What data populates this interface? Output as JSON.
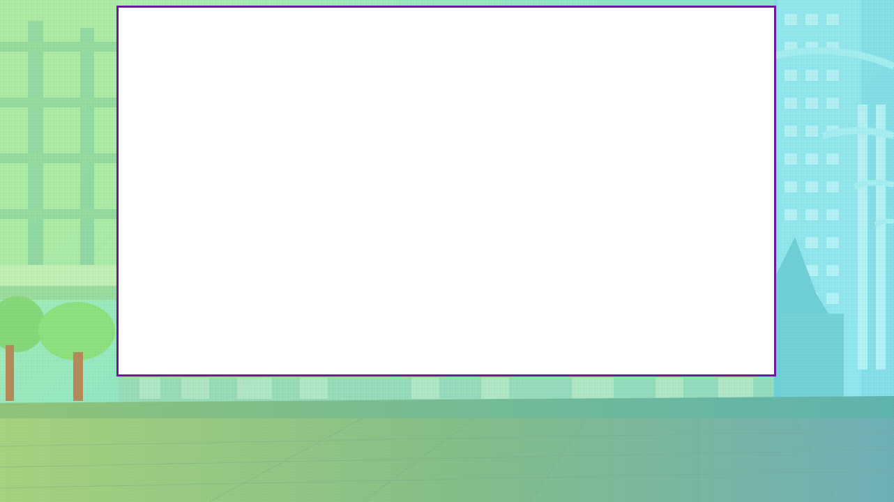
{
  "scene": {
    "background_name": "city-street-backdrop",
    "colors": {
      "sky_cyan": "#7de9ec",
      "foliage_green": "#a9e88a",
      "ground_green": "#86c27a",
      "ground_teal": "#6bb3b0",
      "panel_border": "#6a1a9a",
      "panel_fill": "#ffffff"
    }
  },
  "panel": {
    "name": "content-panel",
    "contents": ""
  }
}
